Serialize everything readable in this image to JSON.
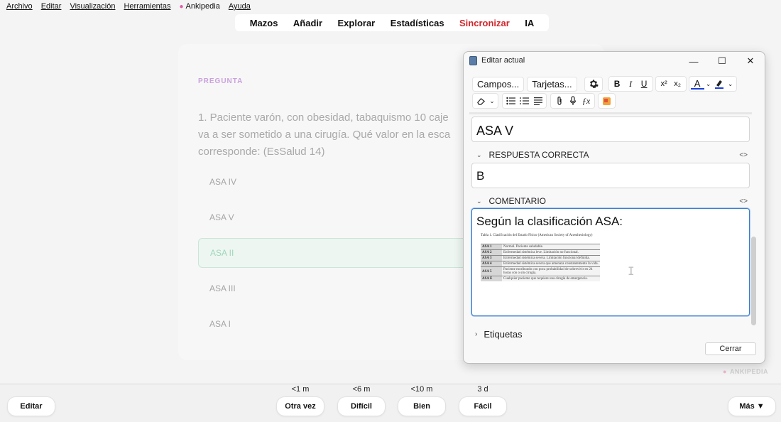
{
  "menubar": {
    "items": [
      "Archivo",
      "Editar",
      "Visualización",
      "Herramientas"
    ],
    "brand_icon": "brain-icon",
    "brand": "Ankipedia",
    "help": "Ayuda"
  },
  "topnav": [
    "Mazos",
    "Añadir",
    "Explorar",
    "Estadísticas",
    "Sincronizar",
    "IA"
  ],
  "colors": {
    "sync": "#d2262c",
    "accent_purple": "#c9a2dd",
    "selected_green": "#9fd7ba",
    "focus_blue": "#3a7dd0"
  },
  "card": {
    "label": "PREGUNTA",
    "question": "1. Paciente varón, con obesidad, tabaquismo 10 caje\nva a ser sometido a una cirugía. Qué valor en la esca\ncorresponde: (EsSalud 14)",
    "options": [
      "ASA IV",
      "ASA V",
      "ASA II",
      "ASA III",
      "ASA I"
    ],
    "selected_index": 2
  },
  "watermark": "ANKIPEDIA",
  "bottom": {
    "edit": "Editar",
    "answers": [
      {
        "interval": "<1 m",
        "label": "Otra vez"
      },
      {
        "interval": "<6 m",
        "label": "Difícil"
      },
      {
        "interval": "<10 m",
        "label": "Bien"
      },
      {
        "interval": "3 d",
        "label": "Fácil"
      }
    ],
    "more": "Más ▼"
  },
  "dialog": {
    "title": "Editar actual",
    "controls": {
      "minimize": "—",
      "maximize": "☐",
      "close": "✕"
    },
    "toolbar": {
      "fields_btn": "Campos...",
      "cards_btn": "Tarjetas...",
      "bold": "B",
      "italic": "I",
      "underline": "U",
      "superscript": "x²",
      "subscript": "x₂",
      "text_color": "A"
    },
    "field_prev_value": "ASA V",
    "fields": [
      {
        "name": "RESPUESTA CORRECTA",
        "value": "B"
      },
      {
        "name": "COMENTARIO",
        "value": "Según la clasificación ASA:"
      }
    ],
    "table_caption": "Tabla 1. Clasificación del Estado Físico (American Society of Anesthesiology)",
    "asa_table": [
      {
        "k": "ASA 1",
        "v": "Normal. Paciente saludable."
      },
      {
        "k": "ASA 2",
        "v": "Enfermedad sistémica leve. Limitación no funcional."
      },
      {
        "k": "ASA 3",
        "v": "Enfermedad sistémica severa. Limitación funcional definida."
      },
      {
        "k": "ASA 4",
        "v": "Enfermedad sistémica severa que amenaza constantemente la vida."
      },
      {
        "k": "ASA 5",
        "v": "Paciente moribundo con poca probabilidad de sobrevivir en 24 horas con o sin cirugía."
      },
      {
        "k": "ASA E",
        "v": "Cualquier paciente que requiere una cirugía de emergencia."
      }
    ],
    "tags_label": "Etiquetas",
    "close_btn": "Cerrar"
  }
}
